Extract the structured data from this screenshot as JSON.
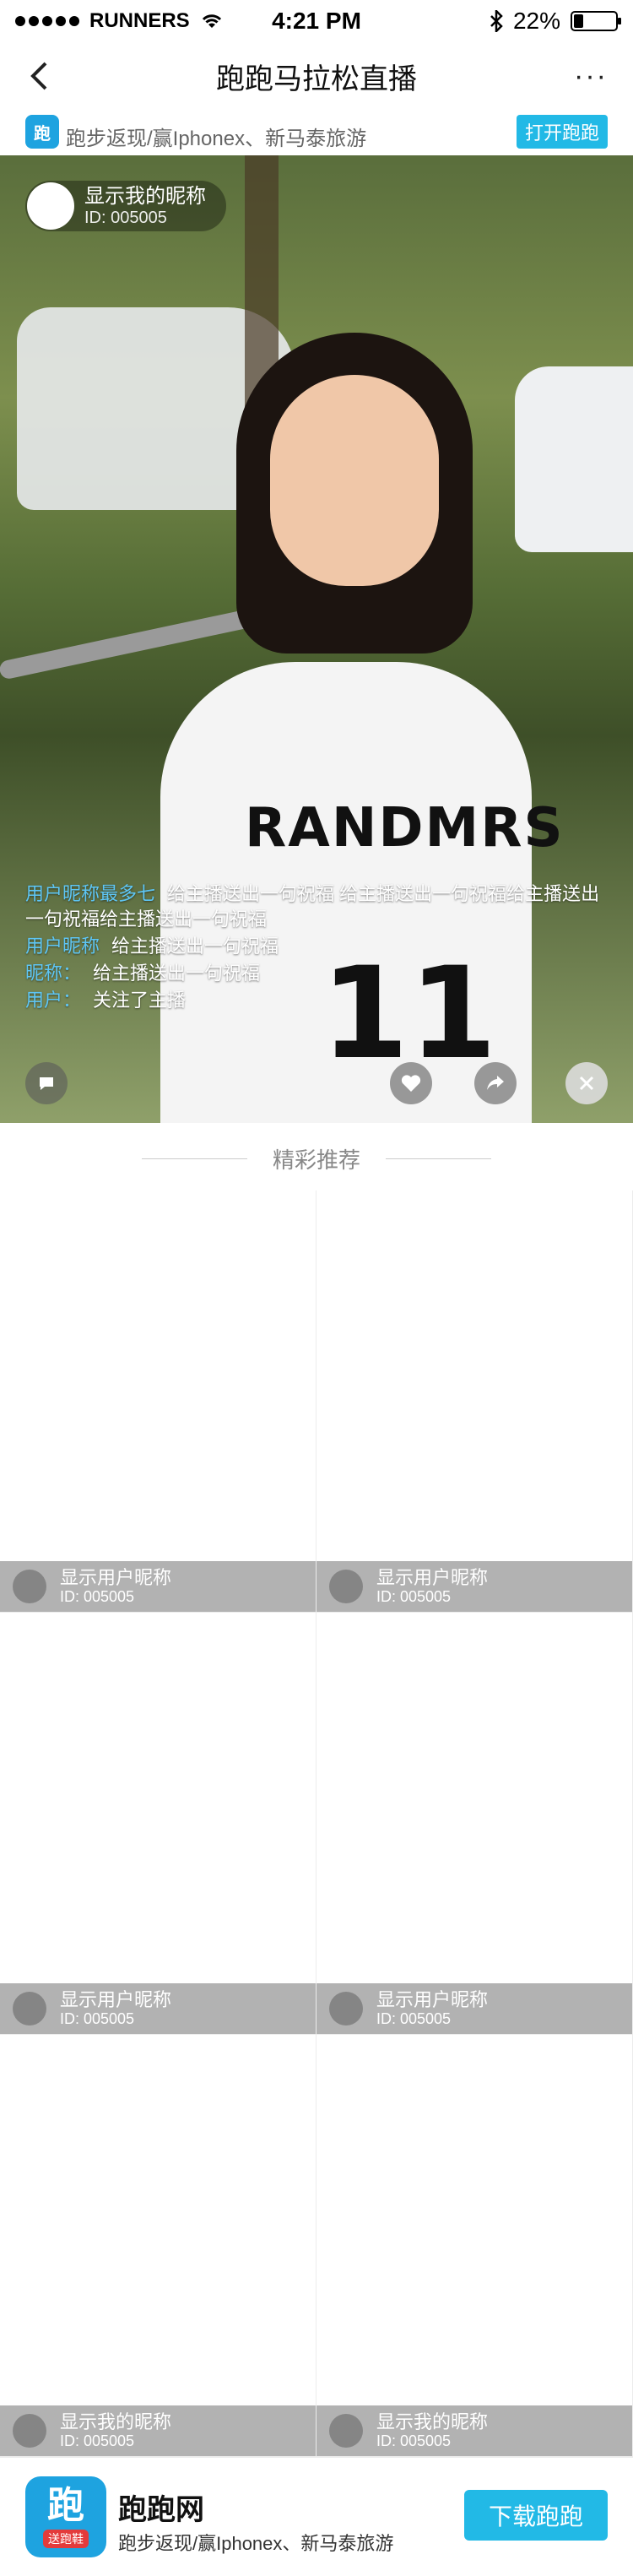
{
  "status_bar": {
    "carrier": "RUNNERS",
    "time": "4:21 PM",
    "battery": "22%",
    "battery_level": 0.22
  },
  "nav": {
    "title": "跑跑马拉松直播",
    "more": "···"
  },
  "promo": {
    "logo": "跑",
    "text": "跑步返现/赢Iphonex、新马泰旅游",
    "open_label": "打开跑跑"
  },
  "host": {
    "name": "显示我的昵称",
    "id": "ID: 005005"
  },
  "shirt": {
    "text": "RANDMRS",
    "number": "11"
  },
  "chat": [
    {
      "user": "用户昵称最多七",
      "msg": "给主播送出一句祝福 给主播送出一句祝福给主播送出一句祝福给主播送出一句祝福"
    },
    {
      "user": "用户昵称",
      "msg": "给主播送出一句祝福"
    },
    {
      "user": "昵称：",
      "msg": "给主播送出一句祝福"
    },
    {
      "user": "用户：",
      "msg": "关注了主播"
    }
  ],
  "recommend": {
    "title": "精彩推荐",
    "items": [
      {
        "name": "显示用户昵称",
        "id": "ID: 005005"
      },
      {
        "name": "显示用户昵称",
        "id": "ID: 005005"
      },
      {
        "name": "显示用户昵称",
        "id": "ID: 005005"
      },
      {
        "name": "显示用户昵称",
        "id": "ID: 005005"
      },
      {
        "name": "显示我的昵称",
        "id": "ID: 005005"
      },
      {
        "name": "显示我的昵称",
        "id": "ID: 005005"
      }
    ]
  },
  "app_banner": {
    "logo_glyph": "跑",
    "logo_badge": "送跑鞋",
    "name": "跑跑网",
    "desc": "跑步返现/赢Iphonex、新马泰旅游",
    "download_label": "下载跑跑"
  },
  "colors": {
    "accent": "#22b9e6",
    "brand": "#1ea3e0",
    "chat_user": "#5ec6f5"
  }
}
